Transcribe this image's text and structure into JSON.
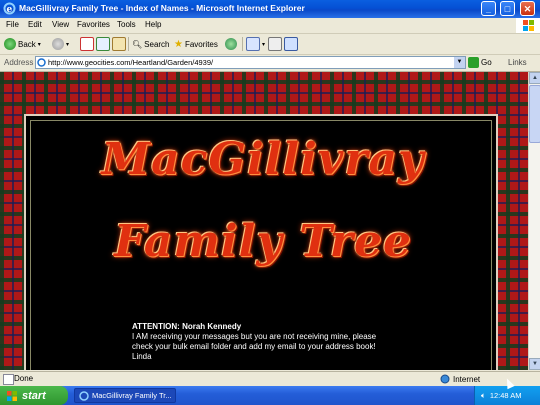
{
  "window": {
    "title": "MacGillivray Family Tree - Index of Names - Microsoft Internet Explorer",
    "buttons": {
      "minimize": "_",
      "maximize": "□",
      "close": "✕"
    }
  },
  "menu": [
    "File",
    "Edit",
    "View",
    "Favorites",
    "Tools",
    "Help"
  ],
  "toolbar": {
    "back": "Back",
    "search": "Search",
    "favorites": "Favorites"
  },
  "address": {
    "label": "Address",
    "url": "http://www.geocities.com/Heartland/Garden/4939/",
    "go": "Go",
    "links": "Links"
  },
  "page": {
    "heading_line1": "MacGillivray",
    "heading_line2": "Family Tree",
    "attention_title": "ATTENTION: Norah Kennedy",
    "attention_body": "I AM receiving your messages but you are not receiving mine, please check your bulk email folder and add my email to your address book!",
    "attention_sign": "Linda"
  },
  "status": {
    "text": "Done",
    "zone": "Internet"
  },
  "taskbar": {
    "start": "start",
    "task_ie": "MacGillivray Family Tr...",
    "clock": "12:48 AM"
  },
  "colors": {
    "title_blue": "#0550d4",
    "tartan_red": "#b01818",
    "heading_red": "#e03010",
    "start_green": "#2e952e"
  }
}
